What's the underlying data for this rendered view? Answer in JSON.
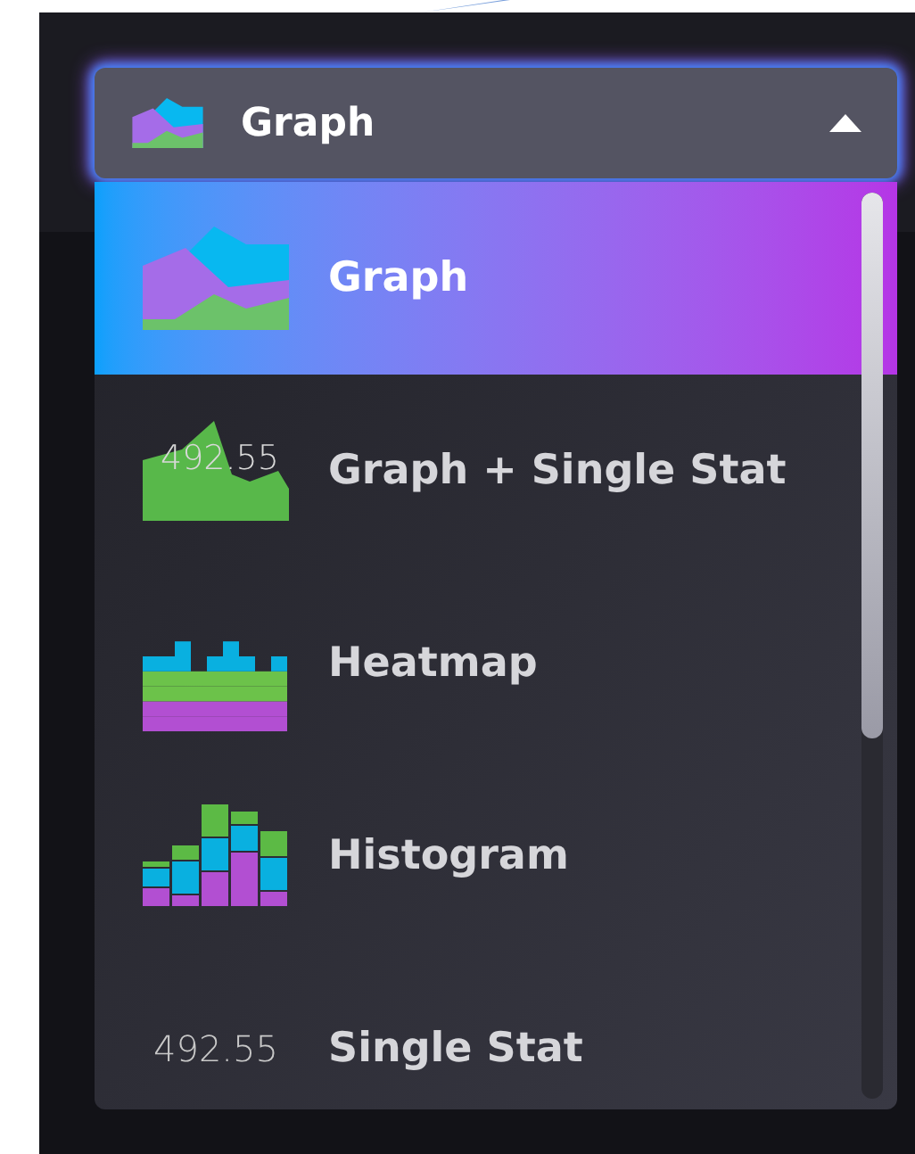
{
  "dropdown": {
    "label": "Graph",
    "expanded": true
  },
  "options": [
    {
      "kind": "graph",
      "label": "Graph",
      "selected": true
    },
    {
      "kind": "graph-single-stat",
      "label": "Graph + Single Stat",
      "stat": "492.55",
      "selected": false
    },
    {
      "kind": "heatmap",
      "label": "Heatmap",
      "selected": false
    },
    {
      "kind": "histogram",
      "label": "Histogram",
      "selected": false
    },
    {
      "kind": "single-stat",
      "label": "Single Stat",
      "stat": "492.55",
      "selected": false
    }
  ]
}
